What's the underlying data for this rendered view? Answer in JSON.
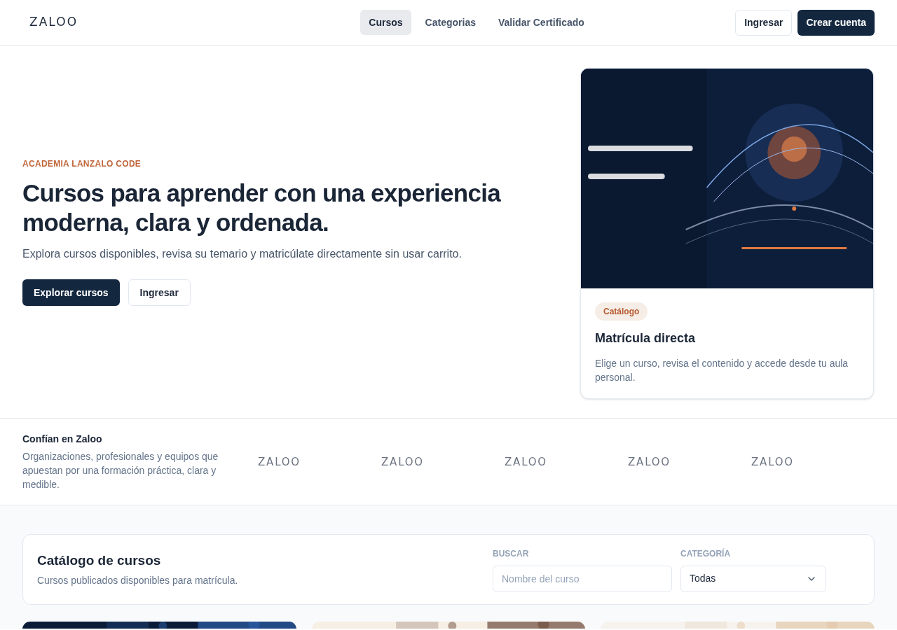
{
  "header": {
    "logo": "ZALOO",
    "nav": [
      {
        "label": "Cursos",
        "selected": true
      },
      {
        "label": "Categorias",
        "selected": false
      },
      {
        "label": "Validar Certificado",
        "selected": false
      }
    ],
    "login": "Ingresar",
    "signup": "Crear cuenta"
  },
  "hero": {
    "eyebrow": "ACADEMIA LANZALO CODE",
    "title": "Cursos para aprender con una experiencia moderna, clara y ordenada.",
    "subtitle": "Explora cursos disponibles, revisa su temario y matricúlate directamente sin usar carrito.",
    "primary": "Explorar cursos",
    "secondary": "Ingresar",
    "card": {
      "badge": "Catálogo",
      "title": "Matrícula directa",
      "text": "Elige un curso, revisa el contenido y accede desde tu aula personal."
    }
  },
  "trust": {
    "title": "Confían en Zaloo",
    "text": "Organizaciones, profesionales y equipos que apuestan por una formación práctica, clara y medible.",
    "logos": [
      "ZALOO",
      "ZALOO",
      "ZALOO",
      "ZALOO",
      "ZALOO"
    ]
  },
  "catalog": {
    "title": "Catálogo de cursos",
    "subtitle": "Cursos publicados disponibles para matrícula.",
    "search": {
      "label": "BUSCAR",
      "placeholder": "Nombre del curso"
    },
    "category": {
      "label": "CATEGORÍA",
      "value": "Todas"
    }
  }
}
